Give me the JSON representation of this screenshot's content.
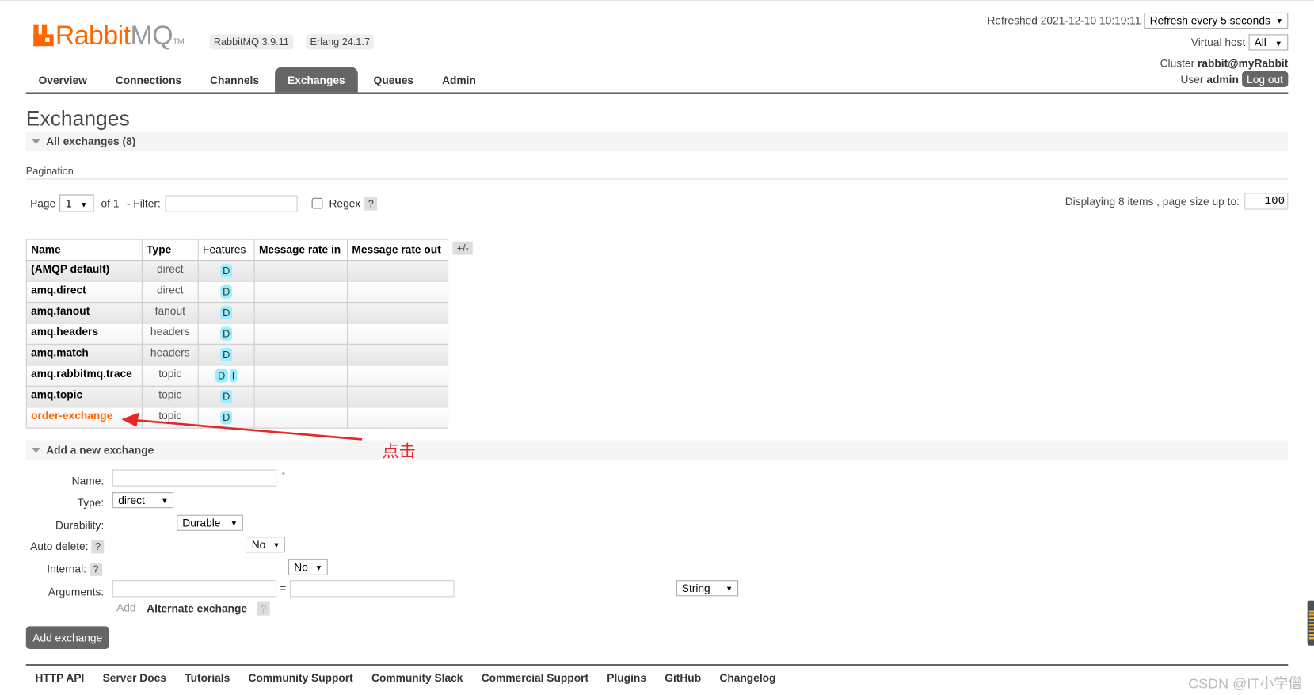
{
  "header": {
    "logo_text": "RabbitMQ",
    "version_badge": "RabbitMQ 3.9.11",
    "erlang_badge": "Erlang 24.1.7",
    "refreshed": "Refreshed 2021-12-10 10:19:11",
    "refresh_select": "Refresh every 5 seconds",
    "vhost_label": "Virtual host",
    "vhost_value": "All",
    "cluster_label": "Cluster",
    "cluster_value": "rabbit@myRabbit",
    "user_label": "User",
    "user_value": "admin",
    "logout": "Log out"
  },
  "nav": {
    "tabs": [
      {
        "label": "Overview"
      },
      {
        "label": "Connections"
      },
      {
        "label": "Channels"
      },
      {
        "label": "Exchanges",
        "active": true
      },
      {
        "label": "Queues"
      },
      {
        "label": "Admin"
      }
    ]
  },
  "page": {
    "title": "Exchanges",
    "all_section": "All exchanges (8)",
    "pagination_label": "Pagination",
    "page_label": "Page",
    "page_value": "1",
    "of_label": "of 1",
    "filter_label": "- Filter:",
    "filter_value": "",
    "regex_label": "Regex",
    "help": "?",
    "displaying": "Displaying 8 items , page size up to:",
    "page_size": "100"
  },
  "table": {
    "columns": [
      "Name",
      "Type",
      "Features",
      "Message rate in",
      "Message rate out"
    ],
    "toggle": "+/-",
    "rows": [
      {
        "name": "(AMQP default)",
        "type": "direct",
        "features": [
          "D"
        ]
      },
      {
        "name": "amq.direct",
        "type": "direct",
        "features": [
          "D"
        ]
      },
      {
        "name": "amq.fanout",
        "type": "fanout",
        "features": [
          "D"
        ]
      },
      {
        "name": "amq.headers",
        "type": "headers",
        "features": [
          "D"
        ]
      },
      {
        "name": "amq.match",
        "type": "headers",
        "features": [
          "D"
        ]
      },
      {
        "name": "amq.rabbitmq.trace",
        "type": "topic",
        "features": [
          "D",
          "I"
        ]
      },
      {
        "name": "amq.topic",
        "type": "topic",
        "features": [
          "D"
        ]
      },
      {
        "name": "order-exchange",
        "type": "topic",
        "features": [
          "D"
        ]
      }
    ]
  },
  "annotation": {
    "text": "点击",
    "color": "#e8262a"
  },
  "add_form": {
    "section": "Add a new exchange",
    "name_label": "Name:",
    "required": "*",
    "type_label": "Type:",
    "type_value": "direct",
    "durability_label": "Durability:",
    "durability_value": "Durable",
    "auto_delete_label": "Auto delete:",
    "auto_delete_value": "No",
    "internal_label": "Internal:",
    "internal_value": "No",
    "arguments_label": "Arguments:",
    "equals": "=",
    "arg_type": "String",
    "add_link": "Add",
    "alternate_exchange": "Alternate exchange",
    "submit": "Add exchange"
  },
  "footer": {
    "links": [
      "HTTP API",
      "Server Docs",
      "Tutorials",
      "Community Support",
      "Community Slack",
      "Commercial Support",
      "Plugins",
      "GitHub",
      "Changelog"
    ],
    "watermark": "CSDN @IT小学僧"
  },
  "colors": {
    "brand": "#ff6600",
    "tab_active": "#666666",
    "feature_badge": "#99eeff",
    "annotation": "#e8262a"
  }
}
